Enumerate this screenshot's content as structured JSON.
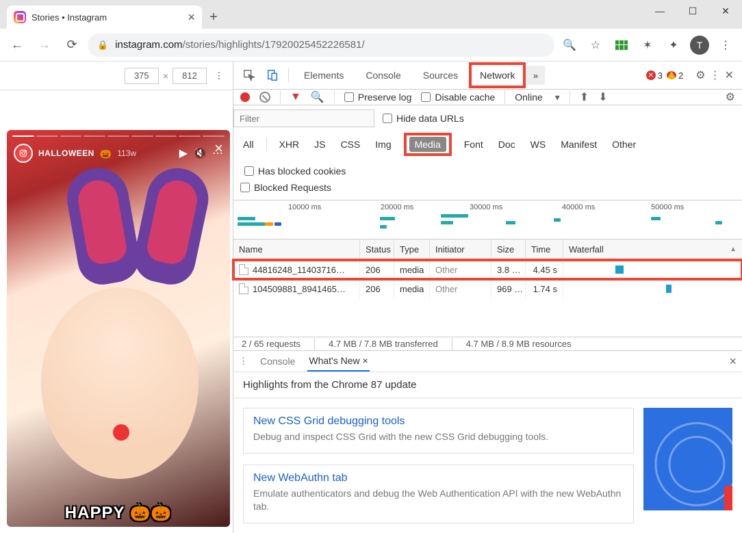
{
  "window": {
    "tab_title": "Stories • Instagram"
  },
  "addr": {
    "domain": "instagram.com",
    "path": "/stories/highlights/17920025452226581/",
    "avatar_initial": "T"
  },
  "device_bar": {
    "width": "375",
    "height": "812"
  },
  "story": {
    "username": "HALLOWEEN",
    "pumpkin": "🎃",
    "age": "113w",
    "banner": "HAPPY"
  },
  "devtools": {
    "tabs": {
      "elements": "Elements",
      "console": "Console",
      "sources": "Sources",
      "network": "Network"
    },
    "errors": "3",
    "warnings": "2"
  },
  "netbar": {
    "preserve": "Preserve log",
    "disable": "Disable cache",
    "online": "Online"
  },
  "filters": {
    "placeholder": "Filter",
    "hide": "Hide data URLs",
    "tags": {
      "all": "All",
      "xhr": "XHR",
      "js": "JS",
      "css": "CSS",
      "img": "Img",
      "media": "Media",
      "font": "Font",
      "doc": "Doc",
      "ws": "WS",
      "manifest": "Manifest",
      "other": "Other"
    },
    "blocked_cookies": "Has blocked cookies",
    "blocked_req": "Blocked Requests"
  },
  "timeline": {
    "t1": "10000 ms",
    "t2": "20000 ms",
    "t3": "30000 ms",
    "t4": "40000 ms",
    "t5": "50000 ms"
  },
  "table": {
    "headers": {
      "name": "Name",
      "status": "Status",
      "type": "Type",
      "initiator": "Initiator",
      "size": "Size",
      "time": "Time",
      "waterfall": "Waterfall"
    },
    "rows": [
      {
        "name": "44816248_11403716…",
        "status": "206",
        "type": "media",
        "initiator": "Other",
        "size": "3.8 …",
        "time": "4.45 s"
      },
      {
        "name": "104509881_8941465…",
        "status": "206",
        "type": "media",
        "initiator": "Other",
        "size": "969 …",
        "time": "1.74 s"
      }
    ]
  },
  "status": {
    "requests": "2 / 65 requests",
    "transferred": "4.7 MB / 7.8 MB transferred",
    "resources": "4.7 MB / 8.9 MB resources"
  },
  "drawer": {
    "console": "Console",
    "whatsnew": "What's New",
    "headline": "Highlights from the Chrome 87 update",
    "cards": [
      {
        "title": "New CSS Grid debugging tools",
        "desc": "Debug and inspect CSS Grid with the new CSS Grid debugging tools."
      },
      {
        "title": "New WebAuthn tab",
        "desc": "Emulate authenticators and debug the Web Authentication API with the new WebAuthn tab."
      }
    ]
  }
}
